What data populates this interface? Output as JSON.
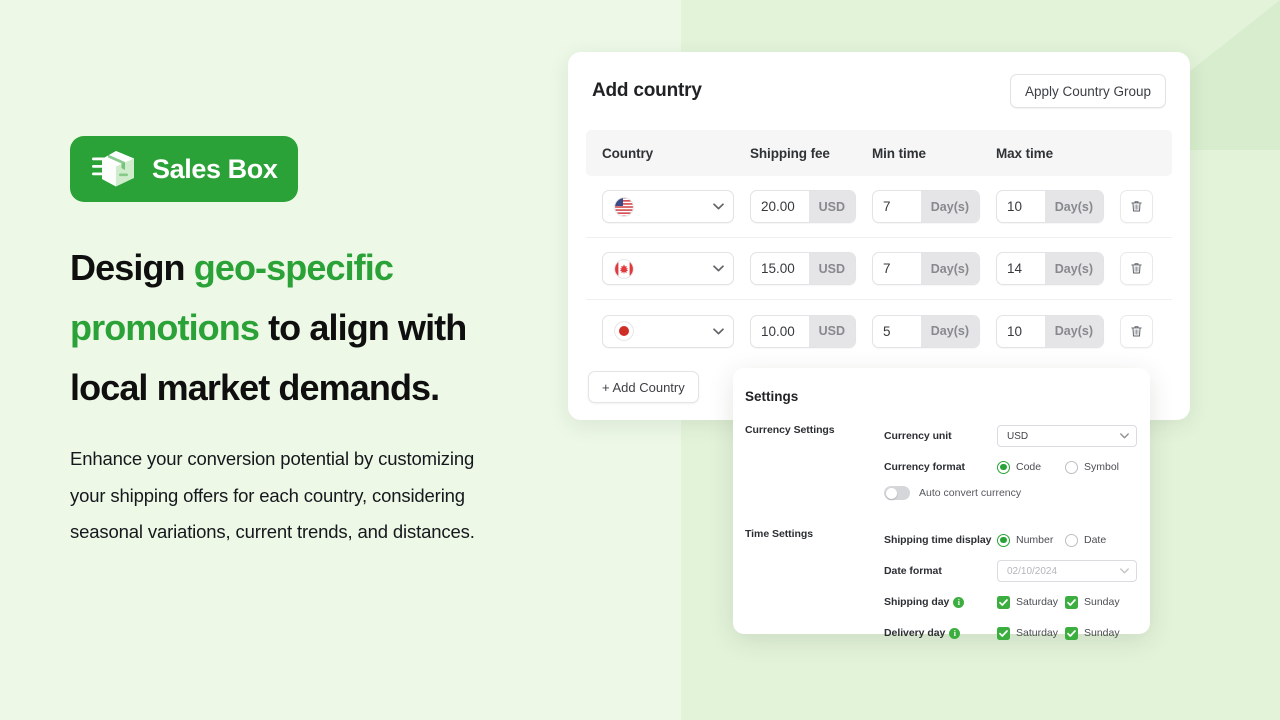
{
  "brand": {
    "name": "Sales Box",
    "logo_icon": "shipping-box-icon",
    "pill_color": "#2aa237"
  },
  "hero": {
    "headline_part1": "Design ",
    "headline_accent1": "geo-specific promotions",
    "headline_part2": " to align with local market demands.",
    "headline_plain": "Design geo-specific promotions to align with local market demands.",
    "body": "Enhance your conversion potential by customizing your shipping offers for each country, considering seasonal variations, current trends, and distances.",
    "accent_color": "#2aa237"
  },
  "card": {
    "title": "Add country",
    "apply_button": "Apply Country Group",
    "add_country_button": "+ Add Country",
    "columns": [
      "Country",
      "Shipping fee",
      "Min time",
      "Max time"
    ],
    "rows": [
      {
        "country": "United States",
        "flag_icon": "flag-us-icon",
        "shipping_fee": "20.00",
        "currency": "USD",
        "min_time": "7",
        "min_unit": "Day(s)",
        "max_time": "10",
        "max_unit": "Day(s)",
        "delete_icon": "trash-icon"
      },
      {
        "country": "Canada",
        "flag_icon": "flag-ca-icon",
        "shipping_fee": "15.00",
        "currency": "USD",
        "min_time": "7",
        "min_unit": "Day(s)",
        "max_time": "14",
        "max_unit": "Day(s)",
        "delete_icon": "trash-icon"
      },
      {
        "country": "Japan",
        "flag_icon": "flag-jp-icon",
        "shipping_fee": "10.00",
        "currency": "USD",
        "min_time": "5",
        "min_unit": "Day(s)",
        "max_time": "10",
        "max_unit": "Day(s)",
        "delete_icon": "trash-icon"
      }
    ]
  },
  "settings": {
    "title": "Settings",
    "currency": {
      "group_label": "Currency Settings",
      "unit_label": "Currency unit",
      "unit_value": "USD",
      "format_label": "Currency format",
      "format_options": [
        "Code",
        "Symbol"
      ],
      "format_selected": "Code",
      "auto_convert_label": "Auto convert currency",
      "auto_convert_on": false
    },
    "time": {
      "group_label": "Time Settings",
      "display_label": "Shipping time display",
      "display_options": [
        "Number",
        "Date"
      ],
      "display_selected": "Number",
      "date_format_label": "Date format",
      "date_format_placeholder": "02/10/2024",
      "shipping_day_label": "Shipping day",
      "delivery_day_label": "Delivery day",
      "day_options": [
        "Saturday",
        "Sunday"
      ],
      "info_icon": "info-icon"
    }
  }
}
